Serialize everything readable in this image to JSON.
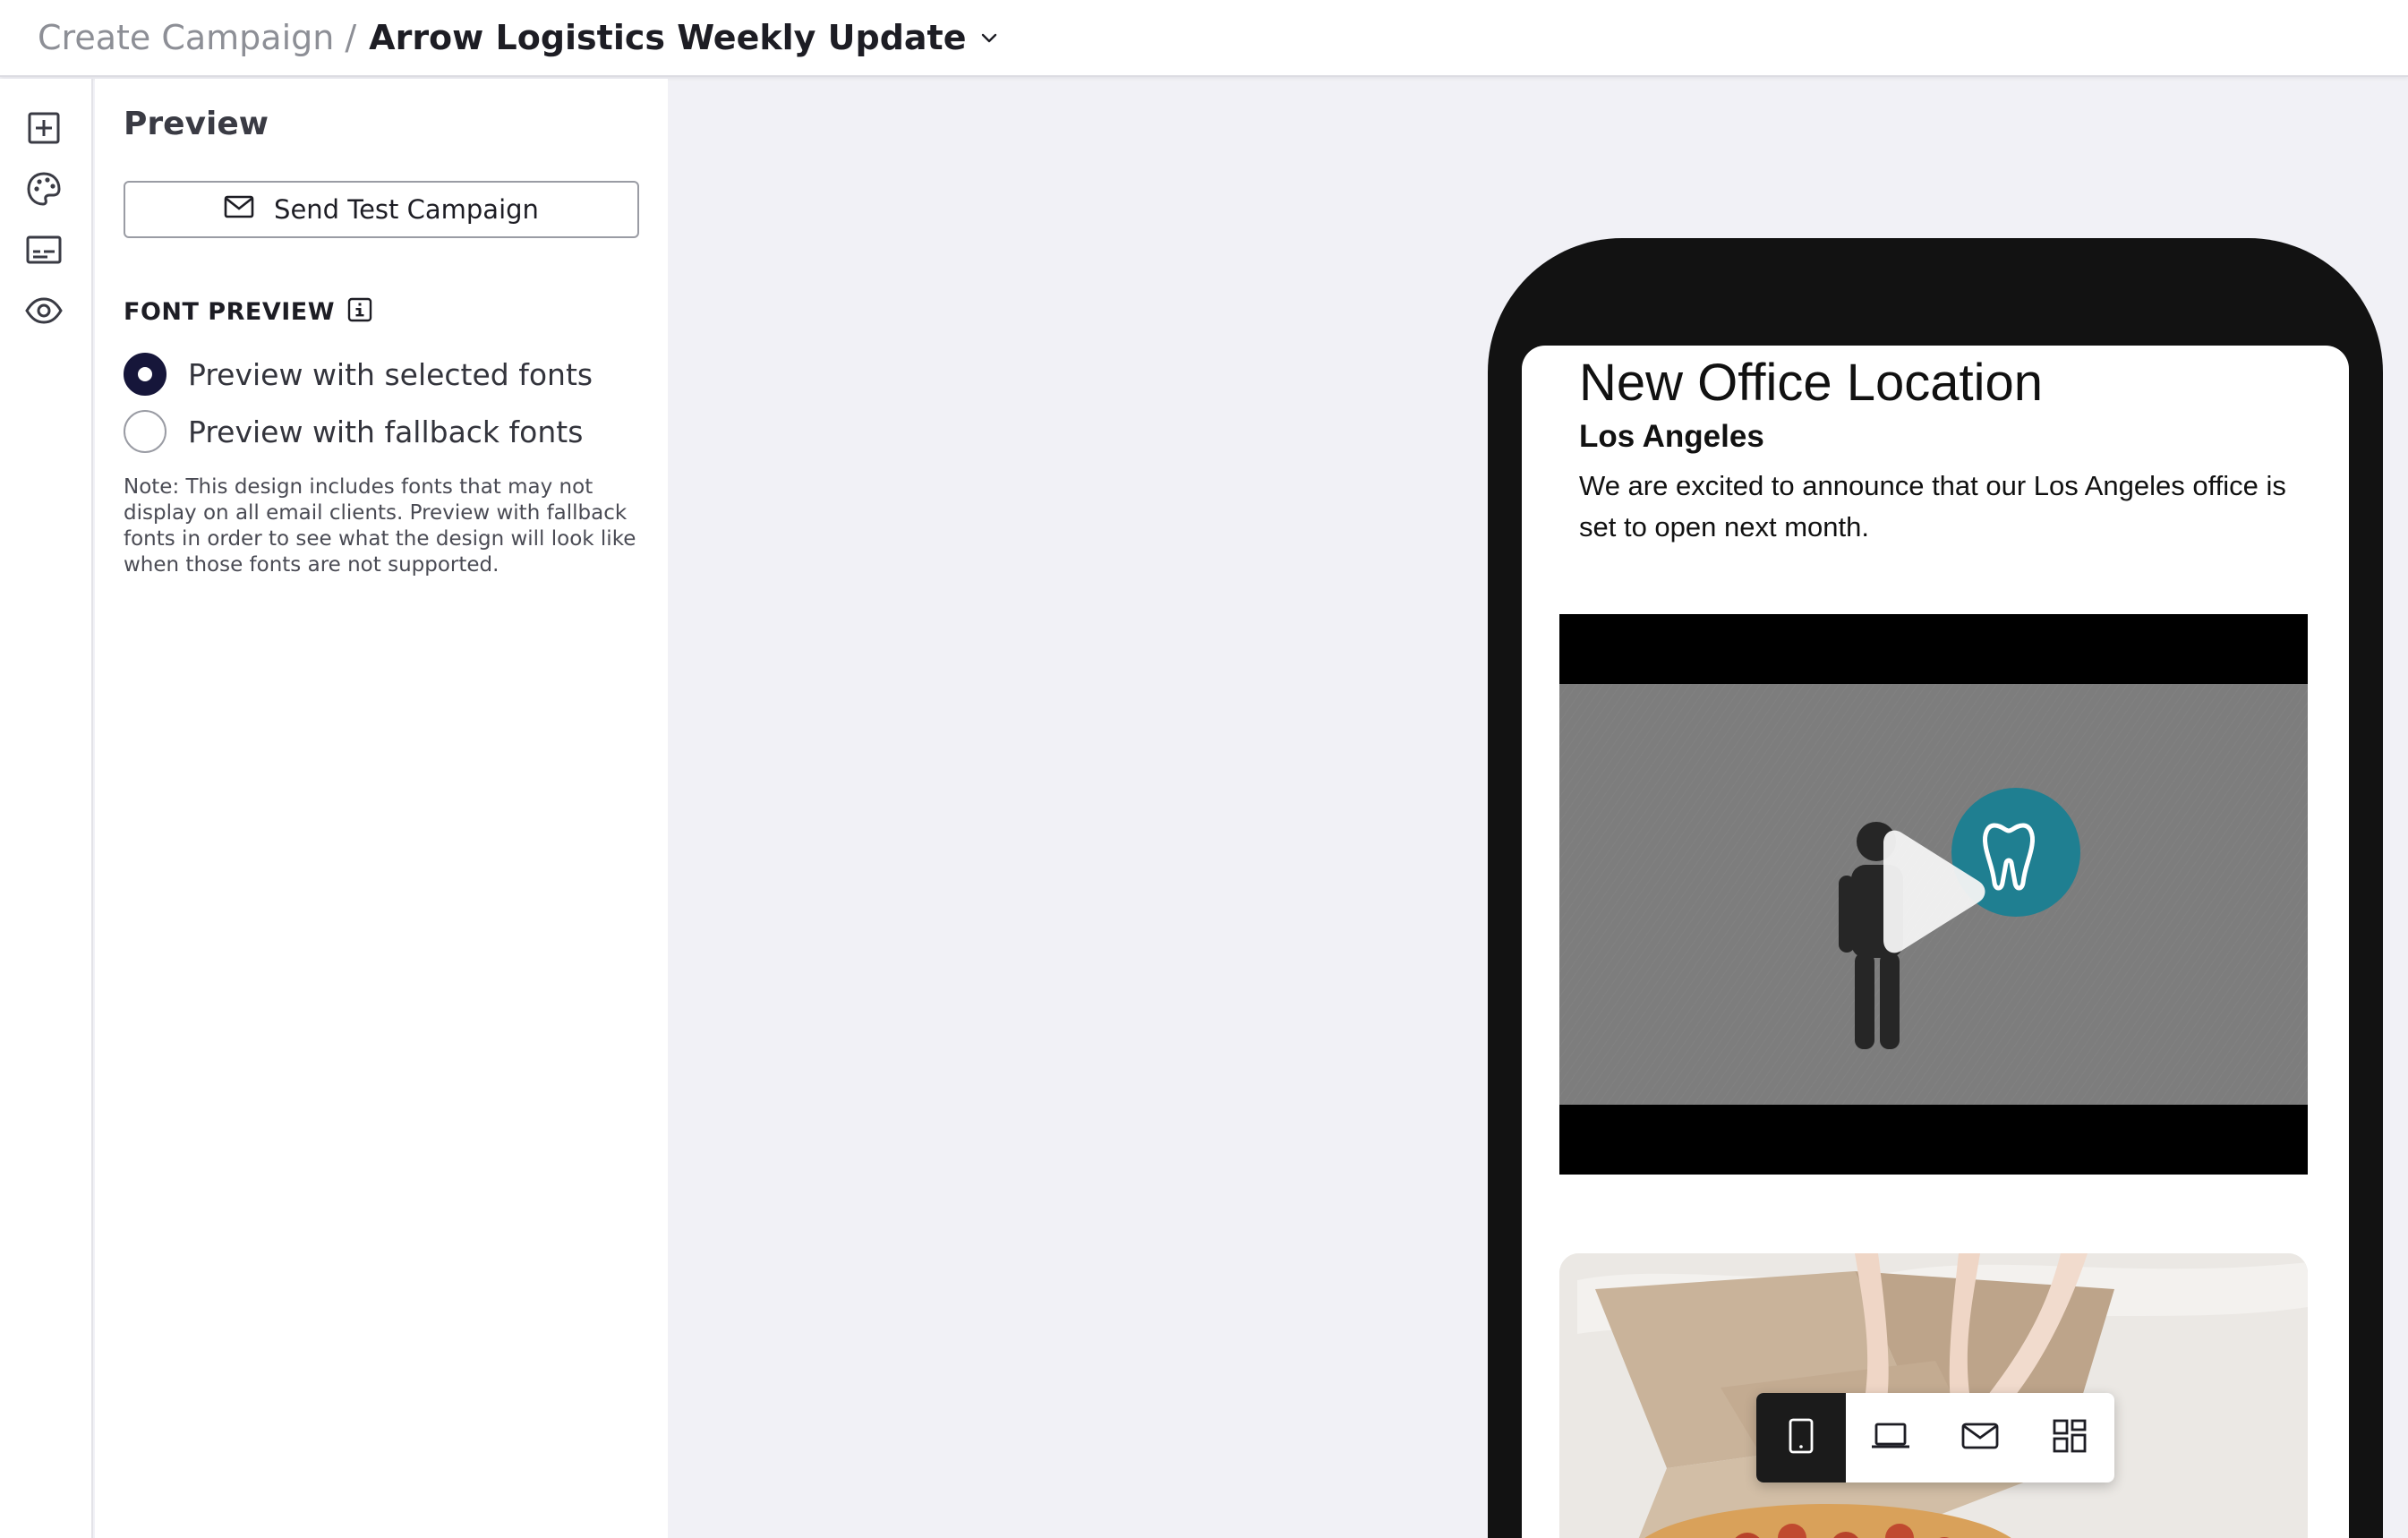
{
  "header": {
    "breadcrumb_root": "Create Campaign",
    "breadcrumb_separator": "/",
    "campaign_title": "Arrow Logistics Weekly Update"
  },
  "rail": {
    "icons": [
      "add-block-icon",
      "palette-icon",
      "content-icon",
      "eye-icon"
    ]
  },
  "panel": {
    "title": "Preview",
    "send_test_label": "Send Test Campaign",
    "font_preview_label": "FONT PREVIEW",
    "options": [
      {
        "label": "Preview with selected fonts",
        "selected": true
      },
      {
        "label": "Preview with fallback fonts",
        "selected": false
      }
    ],
    "note": "Note: This design includes fonts that may not display on all email clients. Preview with fallback fonts in order to see what the design will look like when those fonts are not supported."
  },
  "email": {
    "heading": "New Office Location",
    "subheading": "Los Angeles",
    "body": "We are excited to announce that our Los Angeles office is set to open next month."
  },
  "device_toolbar": {
    "buttons": [
      "mobile-icon",
      "laptop-icon",
      "mail-icon",
      "grid-icon"
    ],
    "active": "mobile-icon"
  },
  "colors": {
    "accent": "#16163a",
    "canvas": "#f1f1f6",
    "phone_frame": "#121212",
    "video_badge": "#1f7f91"
  }
}
